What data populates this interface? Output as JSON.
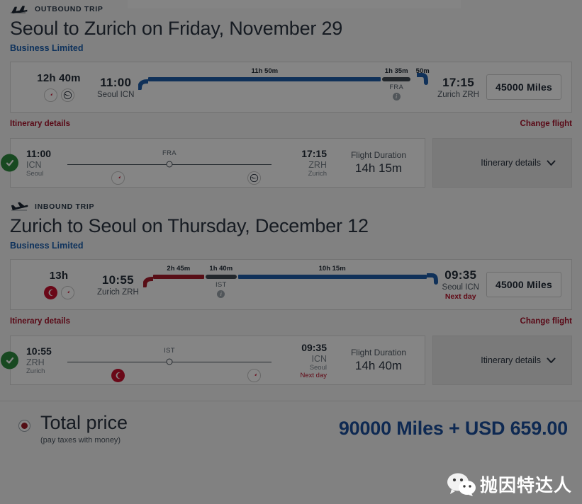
{
  "outbound": {
    "kicker": "OUTBOUND TRIP",
    "plane_icon": "plane-takeoff-icon",
    "title": "Seoul to Zurich on Friday, November 29",
    "fare": "Business Limited",
    "summary": {
      "total_duration": "12h 40m",
      "airlines": [
        "asiana-logo-icon",
        "lufthansa-logo-icon"
      ],
      "depart_time": "11:00",
      "depart_city": "Seoul ICN",
      "arrive_time": "17:15",
      "arrive_city": "Zurich ZRH",
      "legs": [
        {
          "label": "11h 50m",
          "type": "flight",
          "color": "blue"
        },
        {
          "label": "1h 35m",
          "type": "layover",
          "code": "FRA",
          "color": "gray"
        },
        {
          "label": "50m",
          "type": "flight",
          "color": "blue"
        }
      ],
      "miles": "45000 Miles"
    },
    "links": {
      "details": "Itinerary details",
      "change": "Change flight"
    },
    "detail": {
      "status_icon": "check-circle-icon",
      "depart_time": "11:00",
      "depart_code": "ICN",
      "depart_city": "Seoul",
      "stop_code": "FRA",
      "arrive_time": "17:15",
      "arrive_code": "ZRH",
      "arrive_city": "Zurich",
      "duration_label": "Flight Duration",
      "duration_value": "14h 15m",
      "panel_label": "Itinerary details",
      "panel_icon": "chevron-down-icon"
    }
  },
  "inbound": {
    "kicker": "INBOUND TRIP",
    "plane_icon": "plane-landing-icon",
    "title": "Zurich to Seoul on Thursday, December 12",
    "fare": "Business Limited",
    "summary": {
      "total_duration": "13h",
      "airlines": [
        "turkish-airlines-logo-icon",
        "asiana-logo-icon"
      ],
      "depart_time": "10:55",
      "depart_city": "Zurich ZRH",
      "arrive_time": "09:35",
      "arrive_city": "Seoul ICN",
      "arrive_next_day": "Next day",
      "legs": [
        {
          "label": "2h 45m",
          "type": "flight",
          "color": "red"
        },
        {
          "label": "1h 40m",
          "type": "layover",
          "code": "IST",
          "color": "gray"
        },
        {
          "label": "10h 15m",
          "type": "flight",
          "color": "blue"
        }
      ],
      "miles": "45000 Miles"
    },
    "links": {
      "details": "Itinerary details",
      "change": "Change flight"
    },
    "detail": {
      "status_icon": "check-circle-icon",
      "depart_time": "10:55",
      "depart_code": "ZRH",
      "depart_city": "Zurich",
      "stop_code": "IST",
      "arrive_time": "09:35",
      "arrive_code": "ICN",
      "arrive_city": "Seoul",
      "arrive_next_day": "Next day",
      "duration_label": "Flight Duration",
      "duration_value": "14h 40m",
      "panel_label": "Itinerary details",
      "panel_icon": "chevron-down-icon"
    }
  },
  "footer": {
    "radio_icon": "radio-selected-icon",
    "total_label": "Total price",
    "total_sub": "(pay taxes with money)",
    "total_price": "90000 Miles + USD 659.00"
  },
  "watermark": {
    "text": "抛因特达人",
    "logo_icon": "wechat-logo-icon"
  },
  "colors": {
    "accent_blue": "#1b4f9c",
    "link_red": "#a8122b",
    "leg_blue": "#1f5ea8",
    "leg_red": "#a61c2b",
    "leg_gray": "#414a53",
    "check_green": "#2f8b3f"
  }
}
